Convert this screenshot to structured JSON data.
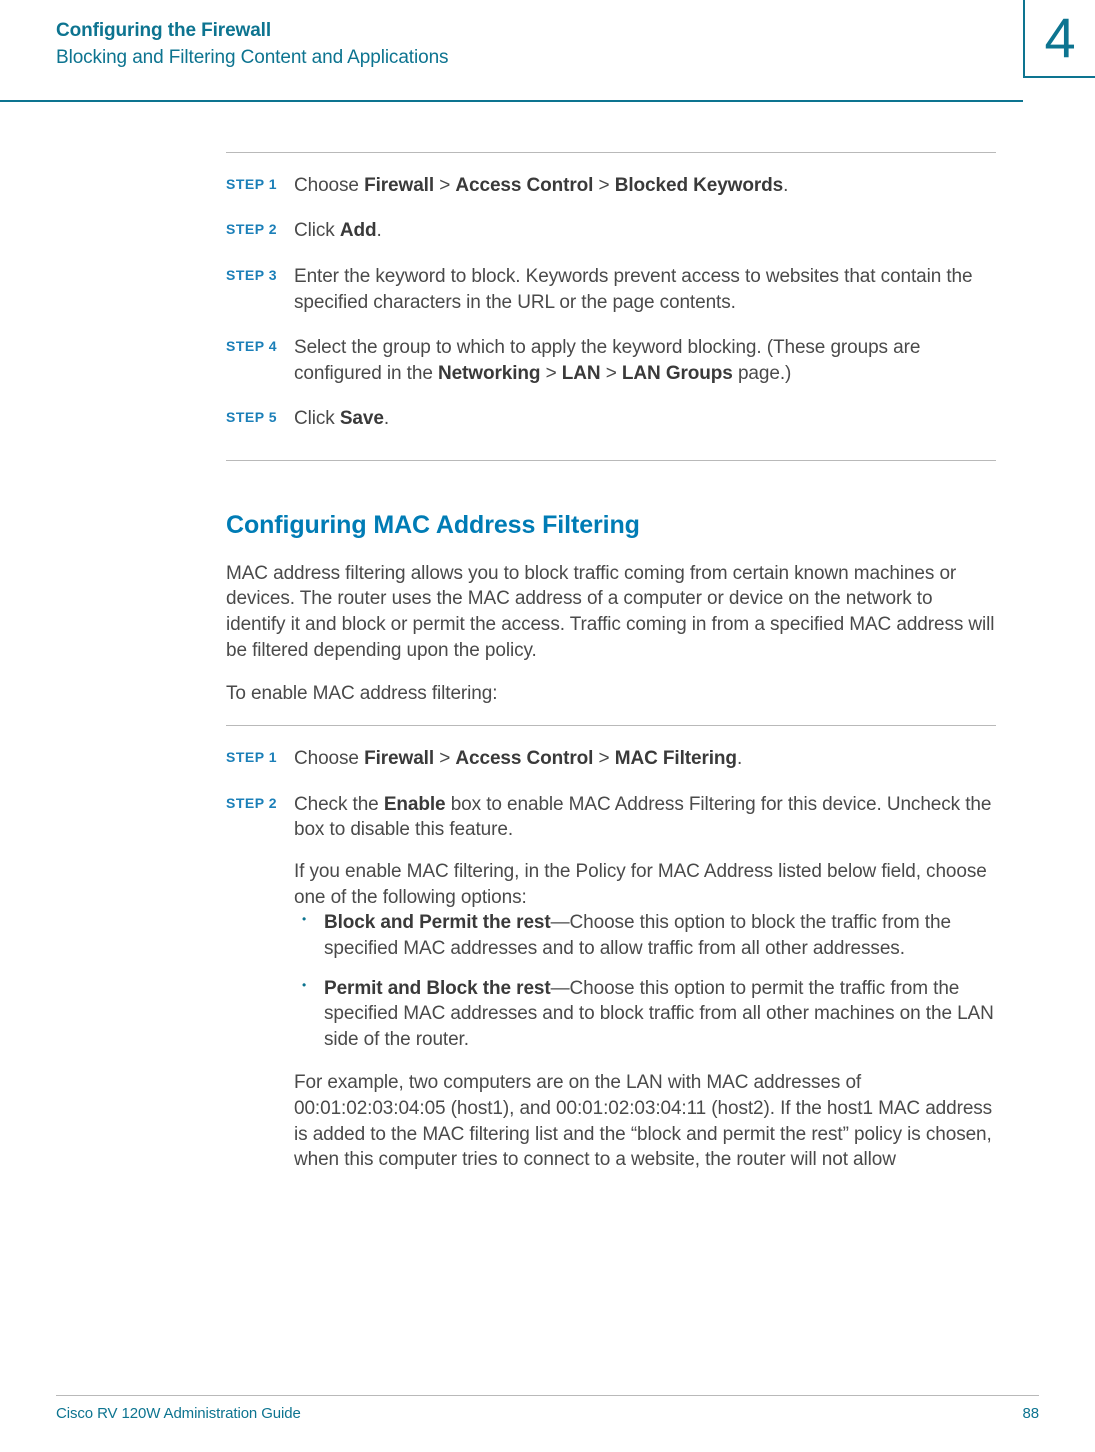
{
  "header": {
    "title": "Configuring the Firewall",
    "subtitle": "Blocking and Filtering Content and Applications",
    "chapter_number": "4"
  },
  "step_label": "STEP ",
  "section_a": {
    "steps": [
      {
        "n": "1",
        "segments": [
          {
            "t": "Choose "
          },
          {
            "t": "Firewall",
            "b": true
          },
          {
            "t": " > "
          },
          {
            "t": "Access Control",
            "b": true
          },
          {
            "t": " > "
          },
          {
            "t": "Blocked Keywords",
            "b": true
          },
          {
            "t": "."
          }
        ]
      },
      {
        "n": "2",
        "segments": [
          {
            "t": "Click "
          },
          {
            "t": "Add",
            "b": true
          },
          {
            "t": "."
          }
        ]
      },
      {
        "n": "3",
        "segments": [
          {
            "t": "Enter the keyword to block. Keywords prevent access to websites that contain the specified characters in the URL or the page contents."
          }
        ]
      },
      {
        "n": "4",
        "segments": [
          {
            "t": "Select the group to which to apply the keyword blocking. (These groups are configured in the "
          },
          {
            "t": "Networking",
            "b": true
          },
          {
            "t": " > "
          },
          {
            "t": "LAN",
            "b": true
          },
          {
            "t": " > "
          },
          {
            "t": "LAN Groups",
            "b": true
          },
          {
            "t": " page.)"
          }
        ]
      },
      {
        "n": "5",
        "segments": [
          {
            "t": "Click "
          },
          {
            "t": "Save",
            "b": true
          },
          {
            "t": "."
          }
        ]
      }
    ]
  },
  "section_b": {
    "heading": "Configuring MAC Address Filtering",
    "intro_p1": "MAC address filtering allows you to block traffic coming from certain known machines or devices. The router uses the MAC address of a computer or device on the network to identify it and block or permit the access. Traffic coming in from a specified MAC address will be filtered depending upon the policy.",
    "intro_p2": "To enable MAC address filtering:",
    "steps": [
      {
        "n": "1",
        "paragraphs": [
          {
            "segments": [
              {
                "t": "Choose "
              },
              {
                "t": "Firewall",
                "b": true
              },
              {
                "t": " > "
              },
              {
                "t": "Access Control",
                "b": true
              },
              {
                "t": " > "
              },
              {
                "t": "MAC Filtering",
                "b": true
              },
              {
                "t": "."
              }
            ]
          }
        ]
      },
      {
        "n": "2",
        "paragraphs": [
          {
            "segments": [
              {
                "t": "Check the "
              },
              {
                "t": "Enable",
                "b": true
              },
              {
                "t": " box to enable MAC Address Filtering for this device. Uncheck the box to disable this feature."
              }
            ]
          },
          {
            "segments": [
              {
                "t": "If you enable MAC filtering, in the Policy for MAC Address listed below field, choose one of the following options:"
              }
            ]
          }
        ],
        "bullets": [
          {
            "segments": [
              {
                "t": "Block and Permit the rest",
                "b": true
              },
              {
                "t": "—Choose this option to block the traffic from the specified MAC addresses and to allow traffic from all other addresses."
              }
            ]
          },
          {
            "segments": [
              {
                "t": "Permit and Block the rest",
                "b": true
              },
              {
                "t": "—Choose this option to permit the traffic from the specified MAC addresses and to block traffic from all other machines on the LAN side of the router."
              }
            ]
          }
        ],
        "after_paragraphs": [
          {
            "segments": [
              {
                "t": "For example, two computers are on the LAN with MAC addresses of 00:01:02:03:04:05 (host1), and 00:01:02:03:04:11 (host2). If the host1 MAC address is added to the MAC filtering list and the “block and permit the rest” policy is chosen, when this computer tries to connect to a website, the router will not allow"
              }
            ]
          }
        ]
      }
    ]
  },
  "footer": {
    "left": "Cisco RV 120W Administration Guide",
    "right": "88"
  }
}
